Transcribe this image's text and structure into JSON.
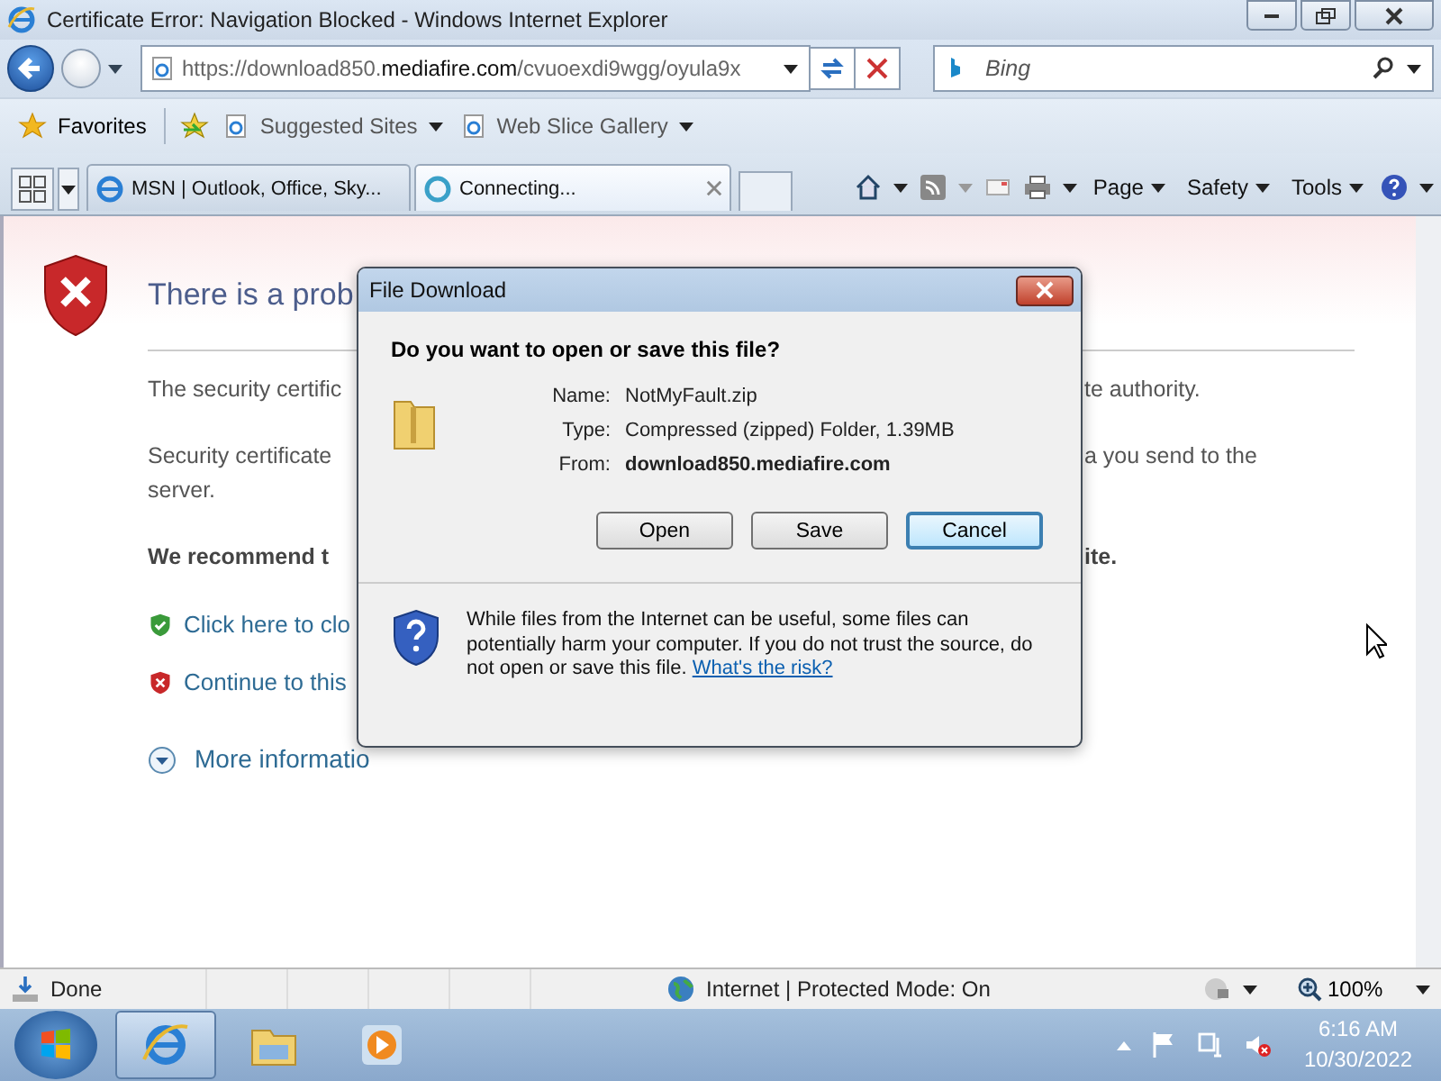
{
  "window": {
    "title": "Certificate Error: Navigation Blocked - Windows Internet Explorer"
  },
  "address_bar": {
    "host": "https://download850.",
    "domain": "mediafire.com",
    "path": "/cvuoexdi9wgg/oyula9x"
  },
  "search": {
    "placeholder": "Bing"
  },
  "favorites_bar": {
    "label": "Favorites",
    "links": [
      "Suggested Sites",
      "Web Slice Gallery"
    ]
  },
  "tabs": [
    {
      "label": "MSN | Outlook, Office, Sky...",
      "selected": false
    },
    {
      "label": "Connecting...",
      "selected": true
    }
  ],
  "command_bar": [
    "Page",
    "Safety",
    "Tools"
  ],
  "page": {
    "title": "There is a prob",
    "rows": [
      {
        "left": [
          "The security certific"
        ],
        "right": "te authority.",
        "bold": false
      },
      {
        "left": [
          "Security certificate",
          "server."
        ],
        "right": "a you send to the",
        "bold": false
      },
      {
        "left": [
          "We recommend t"
        ],
        "right": "ite.",
        "bold": true
      }
    ],
    "links": [
      {
        "kind": "safe",
        "label": "Click here to clo"
      },
      {
        "kind": "danger",
        "label": "Continue to this"
      },
      {
        "kind": "expand",
        "label": "More informatio"
      }
    ]
  },
  "dialog": {
    "title": "File Download",
    "question": "Do you want to open or save this file?",
    "fields": [
      {
        "label": "Name:",
        "value": "NotMyFault.zip",
        "bold": false
      },
      {
        "label": "Type:",
        "value": "Compressed (zipped) Folder, 1.39MB",
        "bold": false
      },
      {
        "label": "From:",
        "value": "download850.mediafire.com",
        "bold": true
      }
    ],
    "buttons": [
      {
        "label": "Open",
        "default": false
      },
      {
        "label": "Save",
        "default": false
      },
      {
        "label": "Cancel",
        "default": true
      }
    ],
    "warning": "While files from the Internet can be useful, some files can potentially harm your computer. If you do not trust the source, do not open or save this file.",
    "risk_link": "What's the risk?"
  },
  "status_bar": {
    "text": "Done",
    "zone": "Internet | Protected Mode: On",
    "zoom": "100%"
  },
  "taskbar": {
    "time": "6:16 AM",
    "date": "10/30/2022"
  }
}
